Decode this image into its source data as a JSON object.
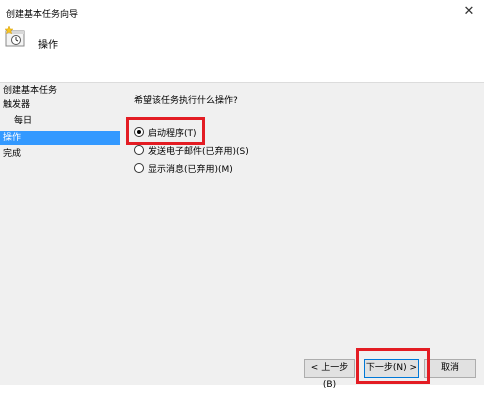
{
  "window": {
    "title": "创建基本任务向导",
    "close_icon": "close-icon"
  },
  "header": {
    "title": "操作",
    "icon": "task-scheduler-icon"
  },
  "nav": {
    "items": [
      {
        "label": "创建基本任务"
      },
      {
        "label": "触发器"
      },
      {
        "label": "每日"
      },
      {
        "label": "操作"
      },
      {
        "label": "完成"
      }
    ]
  },
  "main": {
    "question": "希望该任务执行什么操作?",
    "options": [
      {
        "label": "启动程序(T)",
        "checked": true
      },
      {
        "label": "发送电子邮件(已弃用)(S)",
        "checked": false
      },
      {
        "label": "显示消息(已弃用)(M)",
        "checked": false
      }
    ]
  },
  "buttons": {
    "back": "< 上一步(B)",
    "next": "下一步(N) >",
    "cancel": "取消"
  },
  "colors": {
    "highlight_box": "#e31c23",
    "selected_nav": "#3399ff"
  }
}
